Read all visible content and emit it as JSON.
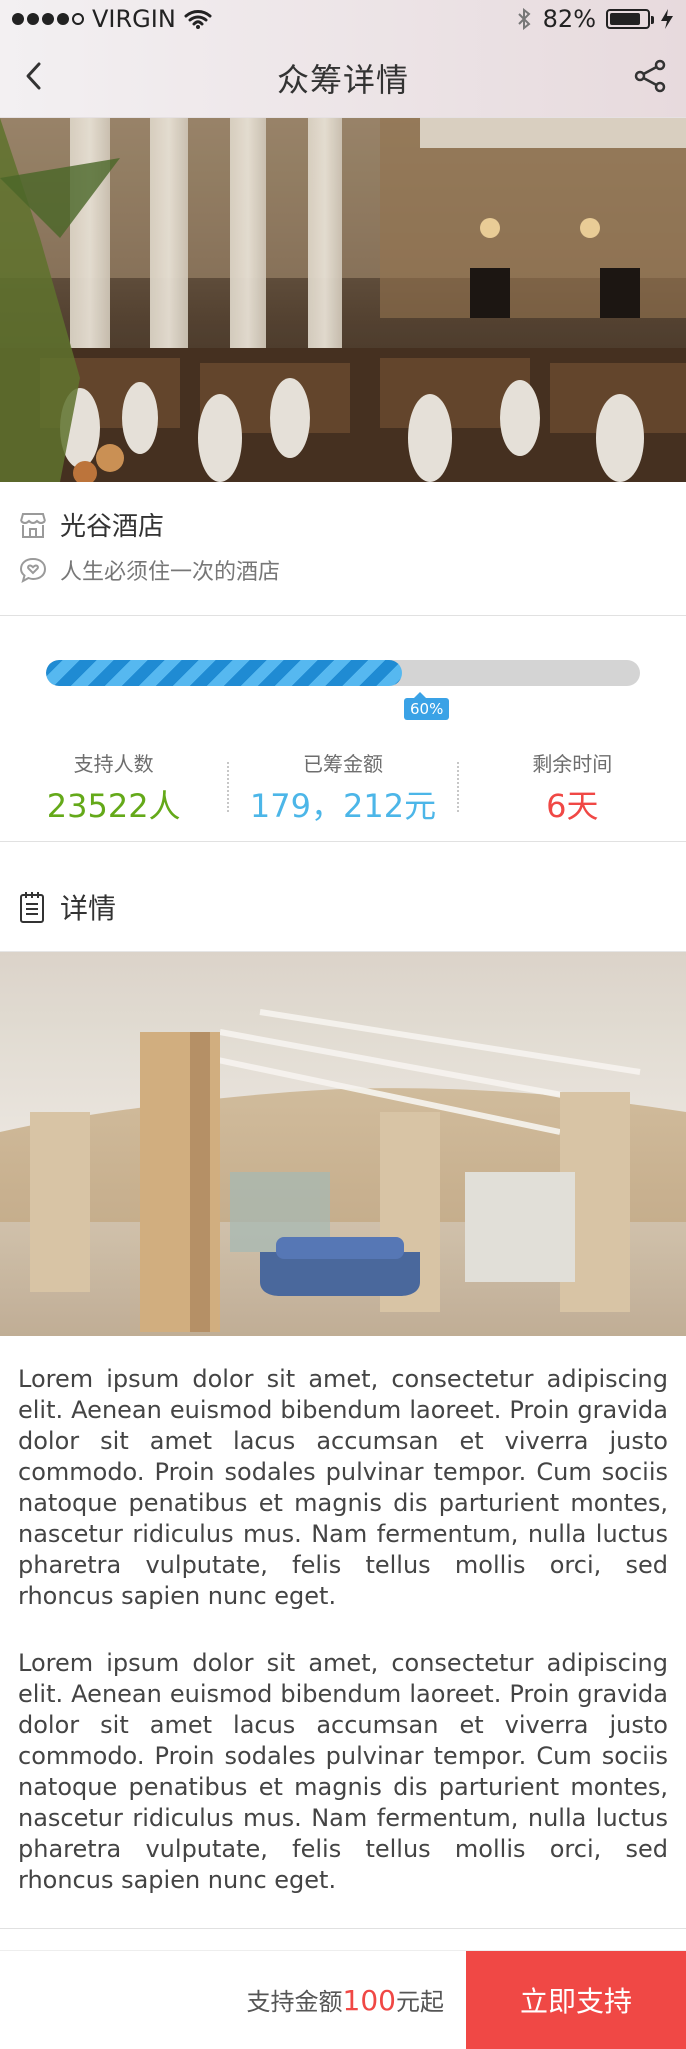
{
  "status_bar": {
    "carrier": "VIRGIN",
    "battery_percent_text": "82%"
  },
  "nav": {
    "title": "众筹详情"
  },
  "hotel": {
    "name": "光谷酒店",
    "slogan": "人生必须住一次的酒店"
  },
  "progress": {
    "label": "60%",
    "value_fraction": 0.6
  },
  "stats": {
    "supporters_label": "支持人数",
    "supporters_value": "23522人",
    "raised_label": "已筹金额",
    "raised_value": "179，212元",
    "remaining_label": "剩余时间",
    "remaining_value": "6天"
  },
  "details": {
    "section_title": "详情",
    "paragraph1": "Lorem ipsum dolor sit amet, consectetur adipiscing elit. Aenean euismod bibendum laoreet. Proin gravida dolor sit amet lacus accumsan et viverra justo commodo. Proin sodales pulvinar tempor. Cum sociis natoque penatibus et magnis dis parturient montes, nascetur ridiculus mus. Nam fermentum, nulla luctus pharetra vulputate, felis tellus mollis orci, sed rhoncus sapien nunc eget.",
    "paragraph2": "Lorem ipsum dolor sit amet, consectetur adipiscing elit. Aenean euismod bibendum laoreet. Proin gravida dolor sit amet lacus accumsan et viverra justo commodo. Proin sodales pulvinar tempor. Cum sociis natoque penatibus et magnis dis parturient montes, nascetur ridiculus mus. Nam fermentum, nulla luctus pharetra vulputate, felis tellus mollis orci, sed rhoncus sapien nunc eget."
  },
  "bottom": {
    "support_prefix": "支持金额",
    "support_amount": "100",
    "support_suffix": "元起",
    "button_label": "立即支持"
  },
  "colors": {
    "accent_red": "#f04845",
    "accent_blue": "#4cb6e8",
    "accent_green": "#64a919"
  },
  "icons": {
    "back": "chevron-left-icon",
    "share": "share-icon",
    "hotel": "store-icon",
    "slogan": "heart-chat-icon",
    "details": "document-icon",
    "wifi": "wifi-icon",
    "bluetooth": "bluetooth-icon",
    "battery": "battery-icon",
    "charging": "charging-icon"
  }
}
